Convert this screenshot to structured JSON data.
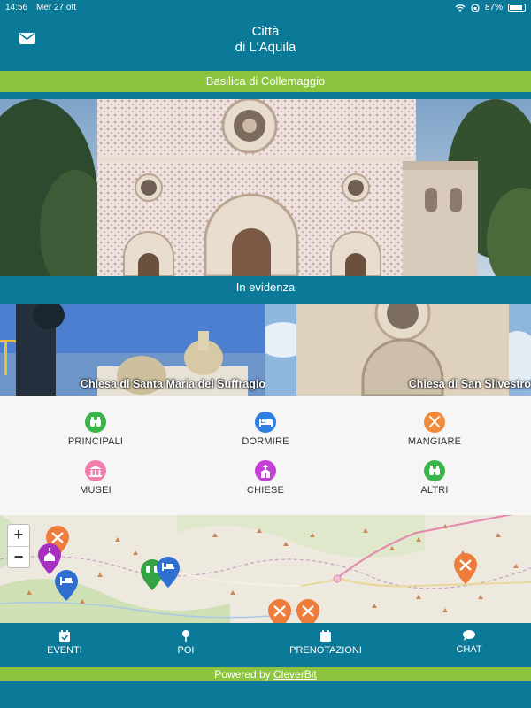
{
  "status": {
    "time": "14:56",
    "date": "Mer 27 ott",
    "battery": "87%"
  },
  "header": {
    "title_line1": "Città",
    "title_line2": "di L'Aquila",
    "mail_icon": "envelope-icon"
  },
  "hero": {
    "caption": "Basilica di Collemaggio"
  },
  "featured": {
    "heading": "In evidenza",
    "items": [
      {
        "caption": "Chiesa di Santa Maria del Suffragio"
      },
      {
        "caption": "Chiesa di San Silvestro"
      }
    ]
  },
  "categories": [
    {
      "label": "PRINCIPALI",
      "color": "#39b54a",
      "icon": "binoculars-icon"
    },
    {
      "label": "DORMIRE",
      "color": "#2f7fe0",
      "icon": "bed-icon"
    },
    {
      "label": "MANGIARE",
      "color": "#f08a3c",
      "icon": "fork-knife-icon"
    },
    {
      "label": "MUSEI",
      "color": "#f07fb0",
      "icon": "museum-icon"
    },
    {
      "label": "CHIESE",
      "color": "#c33fd6",
      "icon": "church-icon"
    },
    {
      "label": "ALTRI",
      "color": "#39b54a",
      "icon": "binoculars-icon"
    }
  ],
  "map": {
    "zoom_in": "+",
    "zoom_out": "−"
  },
  "tabs": [
    {
      "label": "EVENTI",
      "icon": "calendar-check-icon"
    },
    {
      "label": "POI",
      "icon": "pin-icon"
    },
    {
      "label": "PRENOTAZIONI",
      "icon": "calendar-icon"
    },
    {
      "label": "CHAT",
      "icon": "chat-bubble-icon"
    }
  ],
  "footer": {
    "powered_text": "Powered by",
    "brand": "CleverBit"
  },
  "colors": {
    "primary": "#0a7a98",
    "accent": "#8cc43d"
  }
}
